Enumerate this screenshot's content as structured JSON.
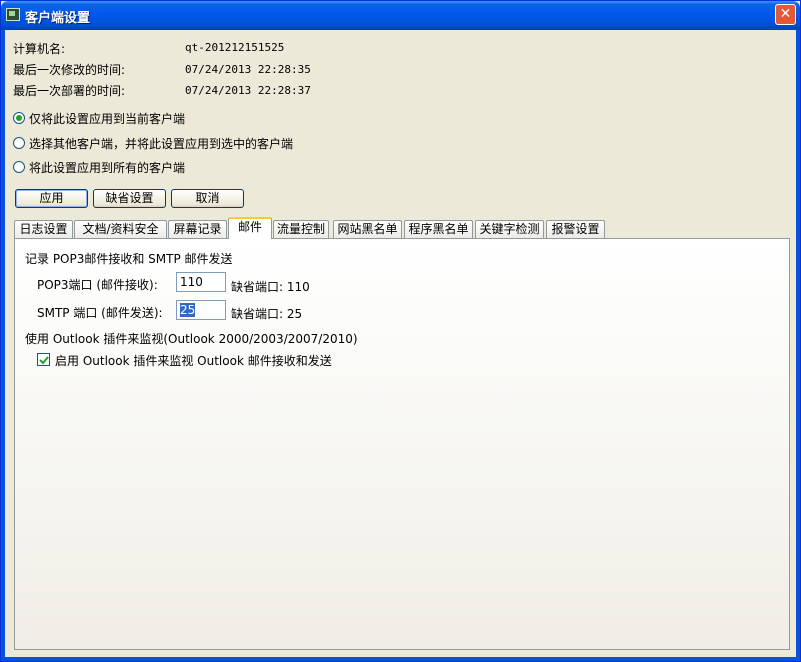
{
  "window": {
    "title": "客户端设置",
    "close_glyph": "✕"
  },
  "info": {
    "computer_name_label": "计算机名:",
    "computer_name_value": "qt-201212151525",
    "last_modified_label": "最后一次修改的时间:",
    "last_modified_value": "07/24/2013 22:28:35",
    "last_deployed_label": "最后一次部署的时间:",
    "last_deployed_value": "07/24/2013 22:28:37"
  },
  "apply_scope": {
    "options": [
      {
        "label": "仅将此设置应用到当前客户端",
        "selected": true
      },
      {
        "label": "选择其他客户端，并将此设置应用到选中的客户端",
        "selected": false
      },
      {
        "label": "将此设置应用到所有的客户端",
        "selected": false
      }
    ]
  },
  "buttons": {
    "apply": "应用",
    "default": "缺省设置",
    "cancel": "取消"
  },
  "tabs": [
    {
      "label": "日志设置"
    },
    {
      "label": "文档/资料安全"
    },
    {
      "label": "屏幕记录"
    },
    {
      "label": "邮件",
      "active": true
    },
    {
      "label": "流量控制"
    },
    {
      "label": "网站黑名单"
    },
    {
      "label": "程序黑名单"
    },
    {
      "label": "关键字检测"
    },
    {
      "label": "报警设置"
    }
  ],
  "mail": {
    "section_record": "记录 POP3邮件接收和 SMTP 邮件发送",
    "pop3_label": "POP3端口 (邮件接收):",
    "pop3_value": "110",
    "pop3_default": "缺省端口: 110",
    "smtp_label": "SMTP 端口 (邮件发送):",
    "smtp_value": "25",
    "smtp_default": "缺省端口: 25",
    "section_outlook": "使用 Outlook 插件来监视(Outlook 2000/2003/2007/2010)",
    "outlook_checkbox_label": "启用 Outlook 插件来监视 Outlook 邮件接收和发送",
    "outlook_checked": true
  },
  "colors": {
    "titlebar": "#0058ee",
    "window_bg": "#ece9d8",
    "tab_highlight": "#ffc83c"
  }
}
